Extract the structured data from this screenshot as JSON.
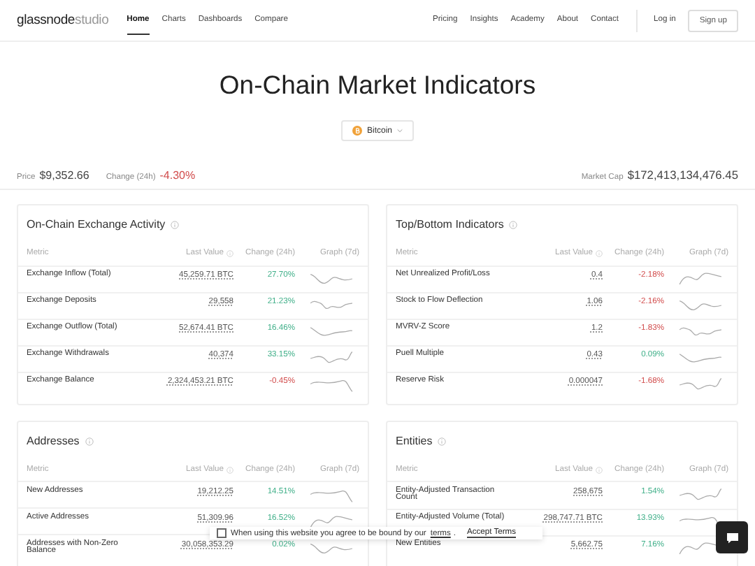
{
  "nav": {
    "logo_bold": "glassnode",
    "logo_light": "studio",
    "links": [
      {
        "label": "Home",
        "selected": true
      },
      {
        "label": "Charts",
        "selected": false
      },
      {
        "label": "Dashboards",
        "selected": false
      },
      {
        "label": "Compare",
        "selected": false
      }
    ],
    "right_links": [
      "Pricing",
      "Insights",
      "Academy",
      "About",
      "Contact"
    ],
    "login": "Log in",
    "signup": "Sign up"
  },
  "title": "On-Chain Market Indicators",
  "asset_select": {
    "value": "Bitcoin"
  },
  "stats": [
    {
      "label": "Price",
      "value": "$9,352.66"
    },
    {
      "label": "Change (24h)",
      "value": "-4.30%",
      "negative": true
    }
  ],
  "market_cap": {
    "label": "Market Cap",
    "value": "$172,413,134,476.45"
  },
  "panels": [
    {
      "title": "On-Chain Exchange Activity",
      "columns": [
        "Metric",
        "Last Value",
        "Change (24h)",
        "Graph (7d)"
      ],
      "rows": [
        {
          "metric": "Exchange Inflow (Total)",
          "last_value": "45,259.71 BTC",
          "change": "27.70%",
          "negative": false
        },
        {
          "metric": "Exchange Deposits",
          "last_value": "29,558",
          "change": "21.23%",
          "negative": false
        },
        {
          "metric": "Exchange Outflow (Total)",
          "last_value": "52,674.41 BTC",
          "change": "16.46%",
          "negative": false
        },
        {
          "metric": "Exchange Withdrawals",
          "last_value": "40,374",
          "change": "33.15%",
          "negative": false
        },
        {
          "metric": "Exchange Balance",
          "last_value": "2,324,453.21 BTC",
          "change": "-0.45%",
          "negative": true
        }
      ]
    },
    {
      "title": "Top/Bottom Indicators",
      "columns": [
        "Metric",
        "Last Value",
        "Change (24h)",
        "Graph (7d)"
      ],
      "rows": [
        {
          "metric": "Net Unrealized Profit/Loss",
          "last_value": "0.4",
          "change": "-2.18%",
          "negative": true
        },
        {
          "metric": "Stock to Flow Deflection",
          "last_value": "1.06",
          "change": "-2.16%",
          "negative": true
        },
        {
          "metric": "MVRV-Z Score",
          "last_value": "1.2",
          "change": "-1.83%",
          "negative": true
        },
        {
          "metric": "Puell Multiple",
          "last_value": "0.43",
          "change": "0.09%",
          "negative": false
        },
        {
          "metric": "Reserve Risk",
          "last_value": "0.000047",
          "change": "-1.68%",
          "negative": true
        }
      ]
    },
    {
      "title": "Addresses",
      "columns": [
        "Metric",
        "Last Value",
        "Change (24h)",
        "Graph (7d)"
      ],
      "rows": [
        {
          "metric": "New Addresses",
          "last_value": "19,212.25",
          "change": "14.51%",
          "negative": false
        },
        {
          "metric": "Active Addresses",
          "last_value": "51,309.96",
          "change": "16.52%",
          "negative": false
        },
        {
          "metric": "Addresses with Non-Zero Balance",
          "last_value": "30,058,353.29",
          "change": "0.02%",
          "negative": false
        }
      ]
    },
    {
      "title": "Entities",
      "columns": [
        "Metric",
        "Last Value",
        "Change (24h)",
        "Graph (7d)"
      ],
      "rows": [
        {
          "metric": "Entity-Adjusted Transaction Count",
          "last_value": "258,675",
          "change": "1.54%",
          "negative": false
        },
        {
          "metric": "Entity-Adjusted Volume (Total)",
          "last_value": "298,747.71 BTC",
          "change": "13.93%",
          "negative": false
        },
        {
          "metric": "New Entities",
          "last_value": "5,662.75",
          "change": "7.16%",
          "negative": false
        }
      ]
    }
  ],
  "cookie_banner": {
    "checked": false,
    "text": "When using this website you agree to be bound by our",
    "link": "terms",
    "period": ".",
    "button": "Accept Terms"
  }
}
